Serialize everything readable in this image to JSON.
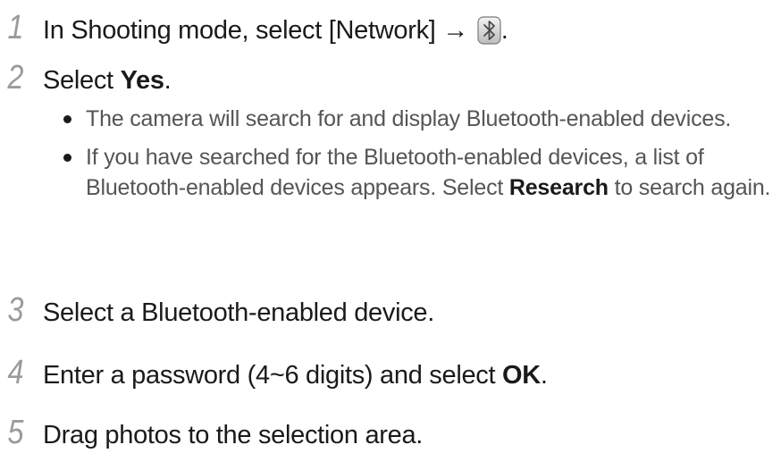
{
  "steps": [
    {
      "number": "1",
      "text_before": "In Shooting mode, select [Network] → ",
      "icon": "bluetooth-icon",
      "text_after": "."
    },
    {
      "number": "2",
      "text_before": "Select ",
      "bold": "Yes",
      "text_after": ".",
      "bullets": [
        {
          "text": "The camera will search for and display Bluetooth-enabled devices."
        },
        {
          "text_before": "If you have searched for the Bluetooth-enabled devices, a list of Bluetooth-enabled devices appears. Select ",
          "bold": "Research",
          "text_after": " to search again."
        }
      ]
    },
    {
      "number": "3",
      "text": "Select a Bluetooth-enabled device."
    },
    {
      "number": "4",
      "text_before": "Enter a password (4~6 digits) and select ",
      "bold": "OK",
      "text_after": "."
    },
    {
      "number": "5",
      "text": "Drag photos to the selection area."
    }
  ]
}
